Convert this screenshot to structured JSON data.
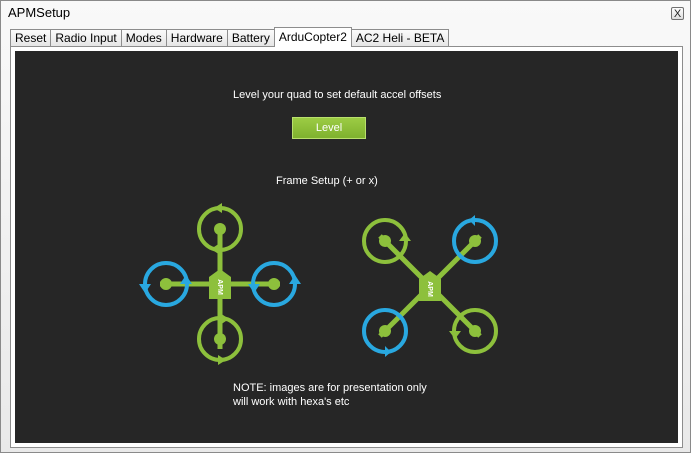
{
  "window": {
    "title": "APMSetup",
    "close_glyph": "X"
  },
  "tabs": [
    {
      "label": "Reset",
      "active": false
    },
    {
      "label": "Radio Input",
      "active": false
    },
    {
      "label": "Modes",
      "active": false
    },
    {
      "label": "Hardware",
      "active": false
    },
    {
      "label": "Battery",
      "active": false
    },
    {
      "label": "ArduCopter2",
      "active": true
    },
    {
      "label": "AC2 Heli - BETA",
      "active": false
    }
  ],
  "panel": {
    "level_instruction": "Level your quad to set default accel offsets",
    "level_button": "Level",
    "frame_setup_label": "Frame Setup (+ or x)",
    "note_line1": "NOTE: images are for presentation only",
    "note_line2": "will work with hexa's etc",
    "frame_plus_label": "APM",
    "frame_x_label": "APM"
  },
  "colors": {
    "panel_bg": "#262626",
    "green": "#8dc03c",
    "blue": "#29a8e0",
    "button_green": "#8cbe3a"
  }
}
